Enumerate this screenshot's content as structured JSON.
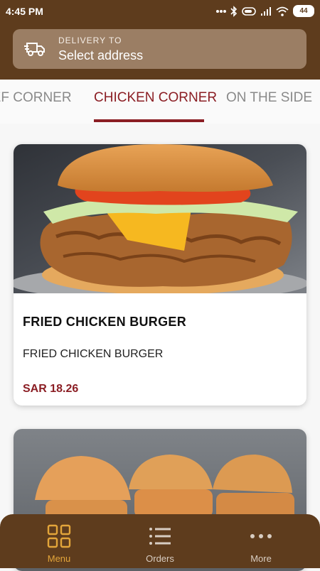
{
  "status_bar": {
    "time": "4:45 PM",
    "battery": "44"
  },
  "delivery": {
    "label": "DELIVERY TO",
    "value": "Select address",
    "icon": "truck-icon"
  },
  "tabs": [
    {
      "label": "BEEF CORNER",
      "visible_text": "EEF CORNER",
      "active": false
    },
    {
      "label": "CHICKEN CORNER",
      "active": true
    },
    {
      "label": "ON THE SIDE",
      "active": false
    }
  ],
  "items": [
    {
      "title": "FRIED CHICKEN BURGER",
      "description": "FRIED CHICKEN BURGER",
      "price": "SAR 18.26",
      "image": "fried chicken burger photo"
    },
    {
      "image": "three slider buns photo"
    }
  ],
  "bottom_nav": [
    {
      "label": "Menu",
      "icon": "grid-icon",
      "active": true
    },
    {
      "label": "Orders",
      "icon": "list-icon",
      "active": false
    },
    {
      "label": "More",
      "icon": "dots-icon",
      "active": false
    }
  ],
  "colors": {
    "header": "#5e3c1d",
    "accent": "#8b1e24",
    "nav_active": "#e3a53a"
  }
}
